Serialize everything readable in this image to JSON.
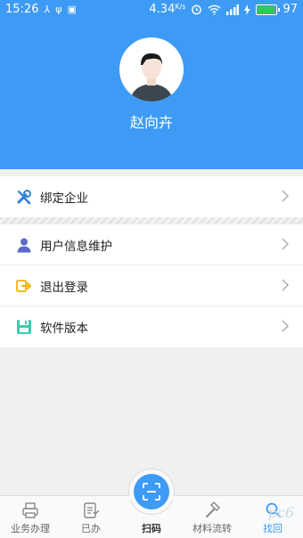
{
  "status_bar": {
    "time": "15:26",
    "left_icons": [
      "⅄",
      "ψ",
      "▣"
    ],
    "speed": "4.34",
    "speed_unit": "K/s",
    "right_icons": [
      "alarm-icon",
      "wifi-icon",
      "signal-icon",
      "charging-icon"
    ],
    "battery_level": "97",
    "battery_fraction": 0.97
  },
  "profile": {
    "name": "赵向卉"
  },
  "menu": {
    "bind_company": "绑定企业",
    "user_info": "用户信息维护",
    "logout": "退出登录",
    "software_version": "软件版本"
  },
  "tabbar": {
    "business": "业务办理",
    "done": "已办",
    "scan": "扫码",
    "materials": "材料流转",
    "find": "找回"
  },
  "watermark": "pc6",
  "colors": {
    "primary": "#3d9bf5",
    "tool_icon": "#2e7fd9",
    "user_icon": "#5b6bc8",
    "logout_icon": "#f5b400",
    "version_icon": "#3ec9b2"
  }
}
